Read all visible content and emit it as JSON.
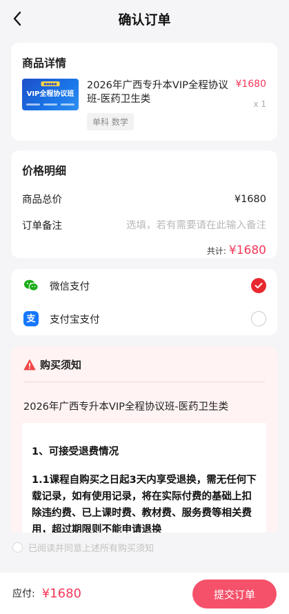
{
  "header": {
    "title": "确认订单"
  },
  "product": {
    "section_title": "商品详情",
    "thumbnail_text": "VIP全程协议班",
    "name": "2026年广西专升本VIP全程协议班-医药卫生类",
    "price": "¥1680",
    "quantity": "x 1",
    "tag": "单科 数学"
  },
  "pricing": {
    "section_title": "价格明细",
    "total_goods_label": "商品总价",
    "total_goods_value": "¥1680",
    "remark_label": "订单备注",
    "remark_placeholder": "选填，若有需要请在此输入备注",
    "sum_label": "共计:",
    "sum_value": "¥1680"
  },
  "payment": {
    "methods": [
      {
        "label": "微信支付",
        "icon": "wechat-pay-icon",
        "selected": true
      },
      {
        "label": "支付宝支付",
        "icon": "alipay-icon",
        "selected": false
      }
    ]
  },
  "notice": {
    "title": "购买须知",
    "course": "2026年广西专升本VIP全程协议班-医药卫生类",
    "heading": "1、可接受退费情况",
    "paragraph": "1.1课程自购买之日起3天内享受退换，需无任何下载记录，如有使用记录，将在实际付费的基础上扣除违约费、已上课时费、教材费、服务费等相关费用，超过期限则不能申请退换"
  },
  "agree": {
    "text": "已阅读并同意上述所有购买须知"
  },
  "footer": {
    "due_label": "应付:",
    "due_value": "¥1680",
    "submit_label": "提交订单"
  },
  "colors": {
    "accent_red": "#f4385a",
    "button_pink": "#f5516a",
    "wechat_green": "#1aad19",
    "alipay_blue": "#1677ff"
  }
}
